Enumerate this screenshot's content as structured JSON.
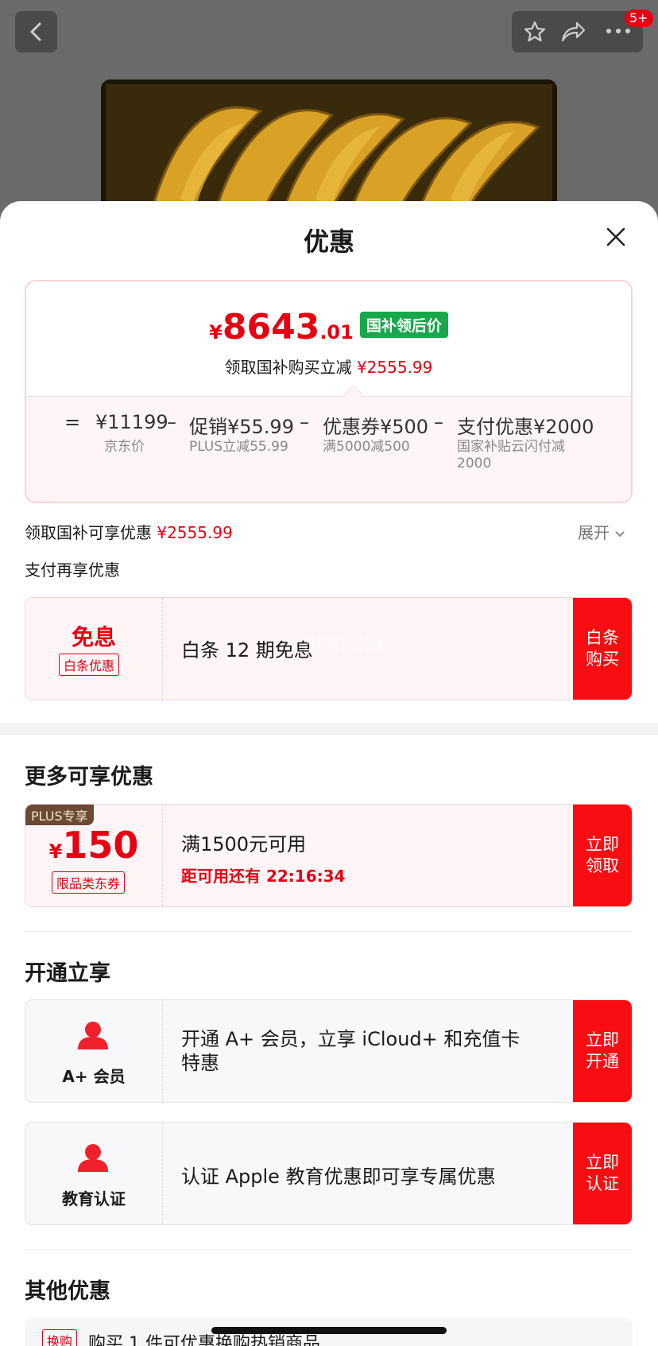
{
  "topbar": {
    "notification_count": "5+"
  },
  "sheet": {
    "title": "优惠"
  },
  "price_card": {
    "currency": "¥",
    "price_int": "8643",
    "price_dec": ".01",
    "tag": "国补领后价",
    "subsidy_label": "领取国补购买立减",
    "subsidy_amount": "¥2555.99",
    "breakdown": [
      {
        "op": "=",
        "value": "¥11199",
        "sub": "京东价"
      },
      {
        "op": "–",
        "value": "促销¥55.99",
        "sub": "PLUS立减55.99"
      },
      {
        "op": "–",
        "value": "优惠券¥500",
        "sub": "满5000减500"
      },
      {
        "op": "–",
        "value": "支付优惠¥2000",
        "sub": "国家补贴云闪付减\n2000"
      }
    ]
  },
  "subsidy_row": {
    "label": "领取国补可享优惠",
    "amount": "¥2555.99",
    "expand": "展开"
  },
  "pay_section": {
    "title": "支付再享优惠",
    "card": {
      "big": "免息",
      "tag": "白条优惠",
      "text": "白条 12 期免息",
      "watermark": "30423SK",
      "button": "白条\n购买"
    }
  },
  "more_section": {
    "title": "更多可享优惠",
    "coupon": {
      "plus": "PLUS专享",
      "sym": "¥",
      "amount": "150",
      "tag": "限品类东券",
      "condition": "满1500元可用",
      "countdown": "距可用还有 22:16:34",
      "button": "立即\n领取"
    }
  },
  "open_section": {
    "title": "开通立享",
    "cards": [
      {
        "label": "A+ 会员",
        "text": "开通 A+ 会员，立享 iCloud+ 和充值卡\n特惠",
        "button": "立即\n开通"
      },
      {
        "label": "教育认证",
        "text": "认证 Apple 教育优惠即可享专属优惠",
        "button": "立即\n认证"
      }
    ]
  },
  "other_section": {
    "title": "其他优惠",
    "partial_tag": "换购",
    "partial_text": "购买 1 件可优惠换购热销商品"
  },
  "colors": {
    "brand_red": "#e60012",
    "button_red": "#f80d12",
    "green_tag": "#16a84a"
  }
}
